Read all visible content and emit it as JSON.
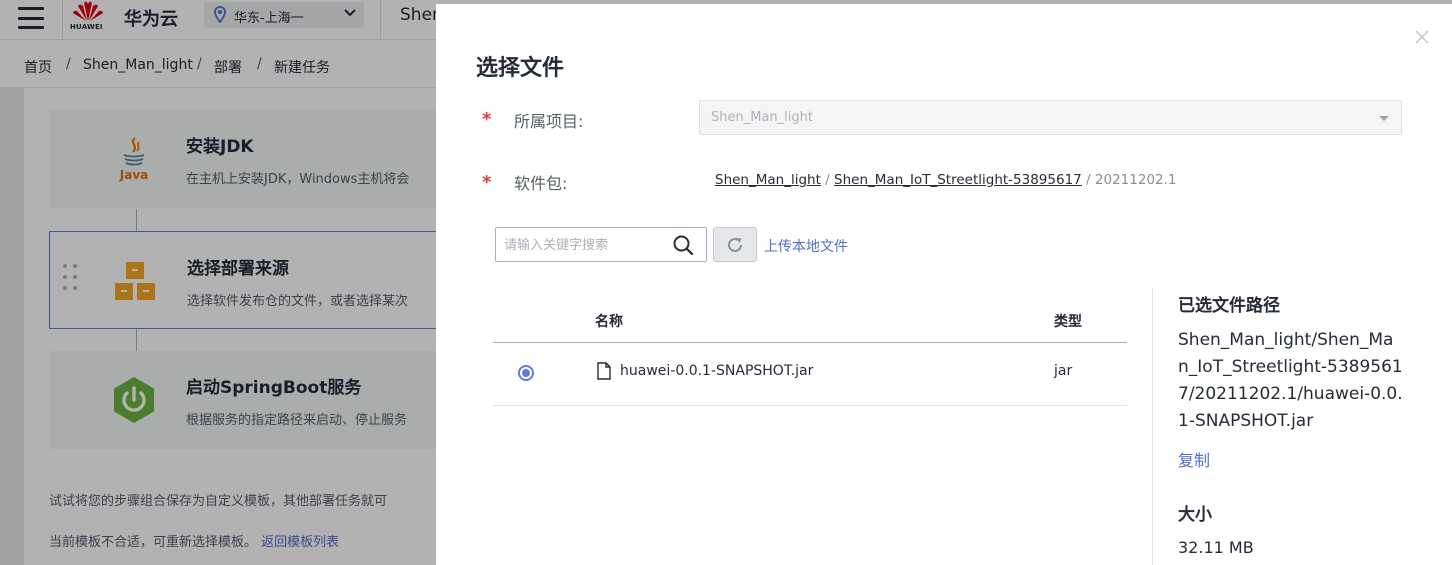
{
  "header": {
    "logo_text": "HUAWEI",
    "brand": "华为云",
    "region": "华东-上海一",
    "project_partial": "Shen"
  },
  "breadcrumb": [
    "首页",
    "Shen_Man_light",
    "部署",
    "新建任务"
  ],
  "breadcrumb_separator": "/",
  "steps": [
    {
      "title": "安装JDK",
      "desc": "在主机上安装JDK，Windows主机将会",
      "icon": "java-icon"
    },
    {
      "title": "选择部署来源",
      "desc": "选择软件发布仓的文件，或者选择某次",
      "icon": "boxes-icon"
    },
    {
      "title": "启动SpringBoot服务",
      "desc": "根据服务的指定路径来启动、停止服务",
      "icon": "spring-icon"
    }
  ],
  "tips": {
    "save_template": "试试将您的步骤组合保存为自定义模板，其他部署任务就可",
    "reselect": "当前模板不合适，可重新选择模板。",
    "back_link": "返回模板列表"
  },
  "drawer": {
    "title": "选择文件",
    "project_label": "所属项目:",
    "project_value": "Shen_Man_light",
    "package_label": "软件包:",
    "package_path": {
      "seg1": "Shen_Man_light",
      "seg2": "Shen_Man_IoT_Streetlight-53895617",
      "seg3": "20211202.1",
      "sep": " / "
    },
    "search_placeholder": "请输入关键字搜索",
    "upload_link": "上传本地文件",
    "table": {
      "headers": {
        "name": "名称",
        "type": "类型"
      },
      "rows": [
        {
          "name": "huawei-0.0.1-SNAPSHOT.jar",
          "type": "jar",
          "selected": true
        }
      ]
    },
    "side": {
      "path_title": "已选文件路径",
      "path_value": "Shen_Man_light/Shen_Man_IoT_Streetlight-53895617/20211202.1/huawei-0.0.1-SNAPSHOT.jar",
      "copy": "复制",
      "size_title": "大小",
      "size_value": "32.11 MB"
    }
  },
  "colors": {
    "accent": "#5e7ce0",
    "link": "#526ecc",
    "required": "#ee3333"
  }
}
